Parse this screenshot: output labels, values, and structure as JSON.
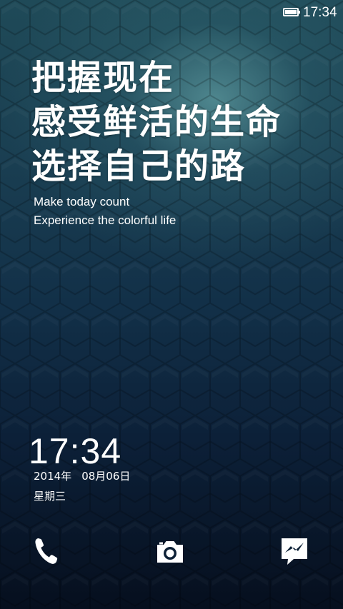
{
  "statusbar": {
    "time": "17:34",
    "battery_icon": "battery-full-icon"
  },
  "slogan": {
    "lines": [
      "把握现在",
      "感受鲜活的生命",
      "选择自己的路"
    ],
    "english": [
      "Make today count",
      "Experience the colorful life"
    ]
  },
  "lockscreen": {
    "clock": "17:34",
    "date_year": "2014年",
    "date_day": "08月06日",
    "weekday": "星期三"
  },
  "shortcuts": [
    {
      "icon": "phone-icon"
    },
    {
      "icon": "camera-icon"
    },
    {
      "icon": "message-icon"
    }
  ],
  "colors": {
    "text": "#ffffff",
    "background_top": "#1f4a58",
    "background_bottom": "#060f1e"
  }
}
